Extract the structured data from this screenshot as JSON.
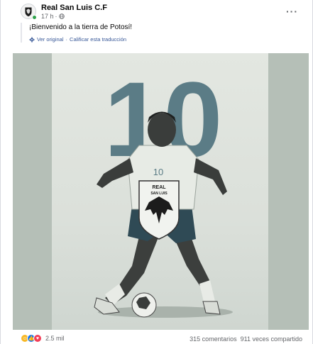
{
  "post": {
    "page_name": "Real San Luis C.F",
    "time_ago": "17 h",
    "separator": "·",
    "more_label": "···",
    "text": "¡Bienvenido a la tierra de Potosí!",
    "see_original": "Ver original",
    "rate_translation": "Calificar esta traducción",
    "translate_separator": "·"
  },
  "image": {
    "shirt_number": "10",
    "big_number": "10",
    "badge_line1": "REAL",
    "badge_line2": "SAN LUIS"
  },
  "footer": {
    "reaction_count": "2.5 mil",
    "comments": "315 comentarios",
    "shares": "911 veces compartido"
  },
  "icons": {
    "reactions": [
      "haha-icon",
      "like-icon",
      "love-icon"
    ],
    "privacy": "globe-icon",
    "translate": "translate-gear-icon"
  },
  "colors": {
    "link": "#385898",
    "online": "#31a24c",
    "like": "#1877f2",
    "love": "#f33e58",
    "haha": "#f7b928",
    "number_fill": "#5b7c86"
  }
}
